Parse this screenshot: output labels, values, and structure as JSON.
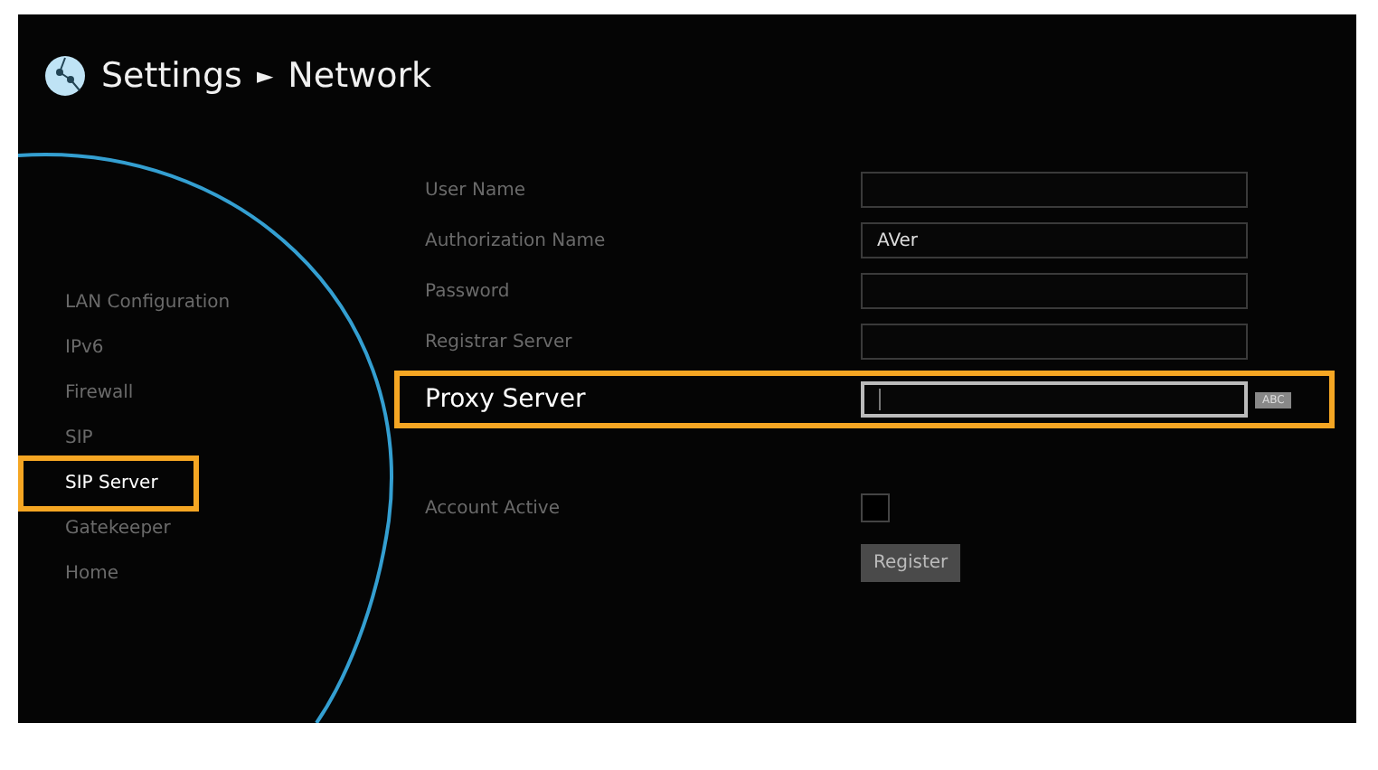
{
  "header": {
    "title": "Settings",
    "separator": "►",
    "subtitle": "Network"
  },
  "sidebar": {
    "items": [
      {
        "label": "LAN Configuration",
        "selected": false
      },
      {
        "label": "IPv6",
        "selected": false
      },
      {
        "label": "Firewall",
        "selected": false
      },
      {
        "label": "SIP",
        "selected": false
      },
      {
        "label": "SIP Server",
        "selected": true
      },
      {
        "label": "Gatekeeper",
        "selected": false
      },
      {
        "label": "Home",
        "selected": false
      }
    ]
  },
  "form": {
    "fields": [
      {
        "label": "User Name",
        "highlighted": false
      },
      {
        "label": "Authorization Name",
        "value": "AVer",
        "highlighted": false
      },
      {
        "label": "Password",
        "highlighted": false
      },
      {
        "label": "Registrar Server",
        "highlighted": false
      },
      {
        "label": "Proxy Server",
        "highlighted": true,
        "input_mode": "ABC"
      }
    ],
    "account_active": {
      "label": "Account Active",
      "checked": false
    },
    "register_button": "Register"
  }
}
